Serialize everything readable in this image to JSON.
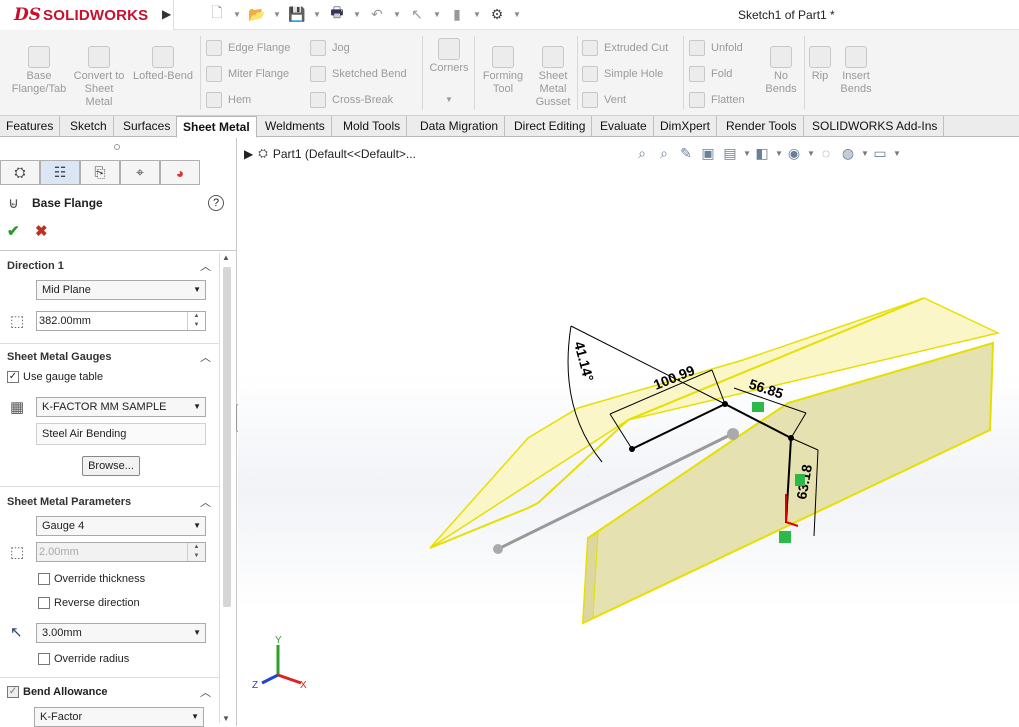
{
  "app": {
    "brand_ds": "DS",
    "brand": "SOLIDWORKS",
    "window_title": "Sketch1 of Part1 *"
  },
  "ribbon": {
    "base_flange": "Base Flange/Tab",
    "convert": "Convert to Sheet Metal",
    "lofted_bend": "Lofted-Bend",
    "edge_flange": "Edge Flange",
    "miter_flange": "Miter Flange",
    "hem": "Hem",
    "jog": "Jog",
    "sketched_bend": "Sketched Bend",
    "cross_break": "Cross-Break",
    "corners": "Corners",
    "forming_tool": "Forming Tool",
    "gusset": "Sheet Metal Gusset",
    "extruded_cut": "Extruded Cut",
    "simple_hole": "Simple Hole",
    "vent": "Vent",
    "unfold": "Unfold",
    "fold": "Fold",
    "flatten": "Flatten",
    "no_bends": "No Bends",
    "rip": "Rip",
    "insert_bends": "Insert Bends"
  },
  "tabs": [
    "Features",
    "Sketch",
    "Surfaces",
    "Sheet Metal",
    "Weldments",
    "Mold Tools",
    "Data Migration",
    "Direct Editing",
    "Evaluate",
    "DimXpert",
    "Render Tools",
    "SOLIDWORKS Add-Ins"
  ],
  "active_tab": "Sheet Metal",
  "property_manager": {
    "title": "Base Flange",
    "help": "?",
    "direction1": {
      "label": "Direction 1",
      "end_condition": "Mid Plane",
      "depth": "382.00mm"
    },
    "gauges": {
      "label": "Sheet Metal Gauges",
      "use_gauge_table": "Use gauge table",
      "use_gauge_checked": true,
      "table": "K-FACTOR MM SAMPLE",
      "description": "Steel Air Bending",
      "browse": "Browse..."
    },
    "parameters": {
      "label": "Sheet Metal Parameters",
      "gauge": "Gauge 4",
      "thickness": "2.00mm",
      "override_thickness": "Override thickness",
      "reverse_direction": "Reverse direction",
      "radius": "3.00mm",
      "override_radius": "Override radius"
    },
    "bend_allowance": {
      "label": "Bend Allowance",
      "type": "K-Factor"
    }
  },
  "tree": {
    "label": "Part1  (Default<<Default>..."
  },
  "dimensions": {
    "angle": "41.14°",
    "length1": "100.99",
    "length2": "56.85",
    "height": "63.18"
  },
  "triad": {
    "x": "X",
    "y": "Y",
    "z": "Z"
  }
}
